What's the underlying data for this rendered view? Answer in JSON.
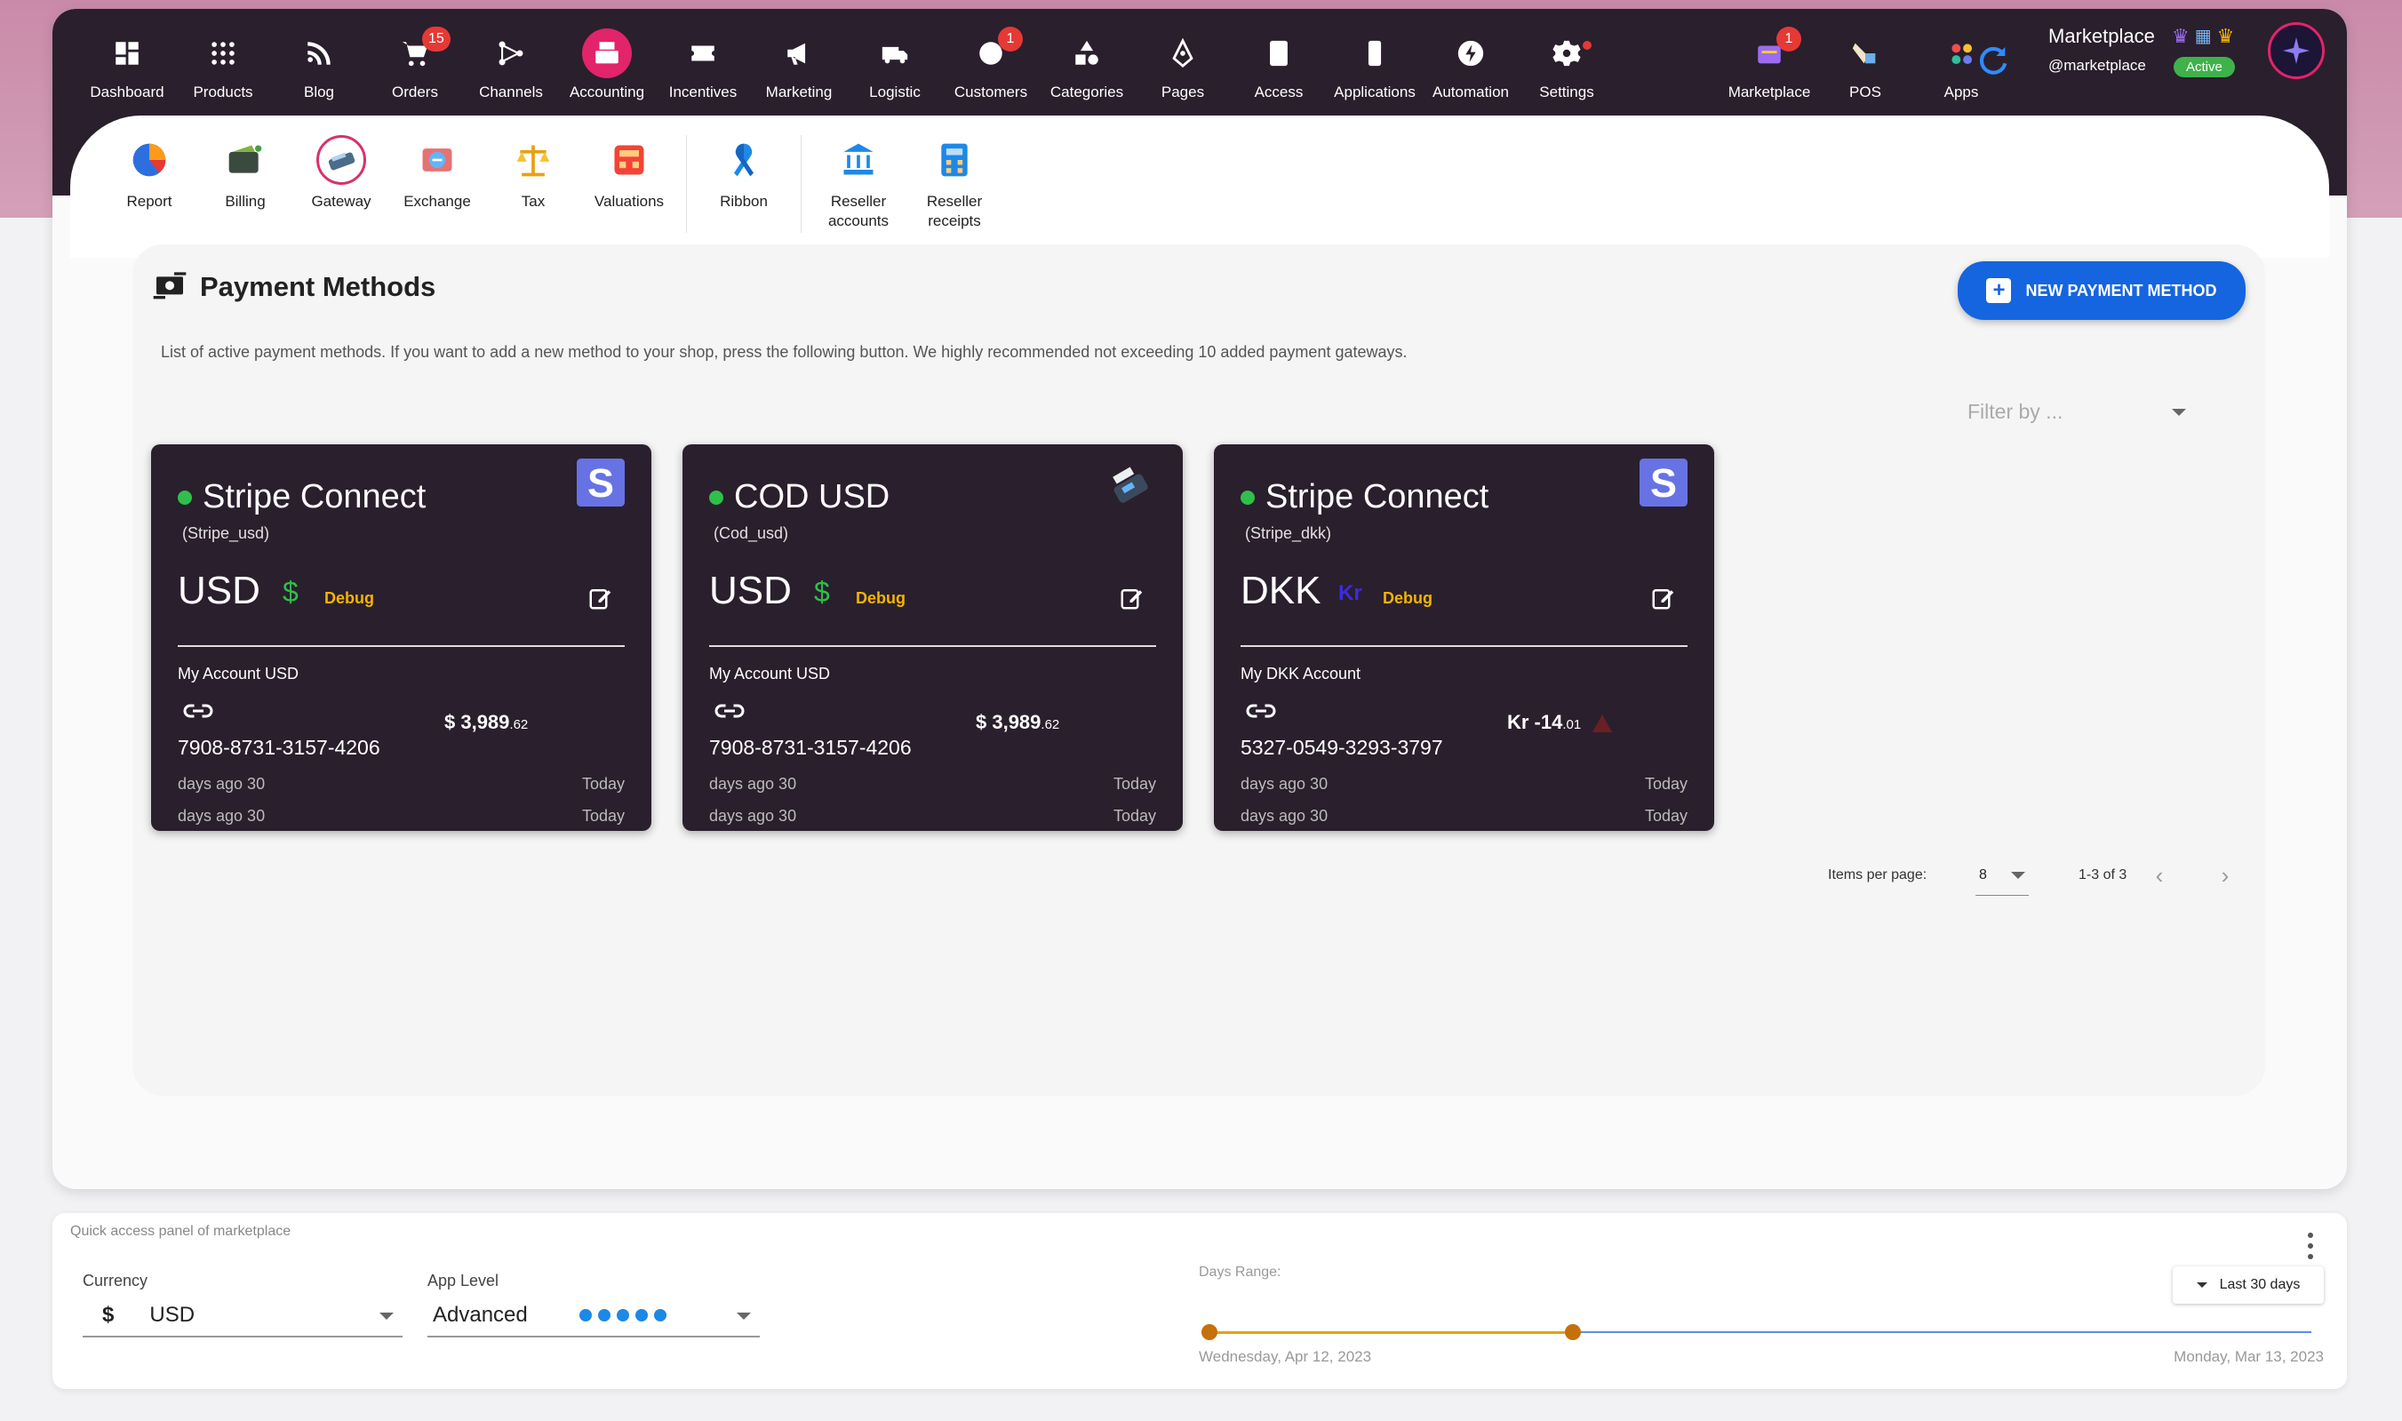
{
  "nav": {
    "items": [
      {
        "label": "Dashboard",
        "icon": "dashboard-icon"
      },
      {
        "label": "Products",
        "icon": "products-icon"
      },
      {
        "label": "Blog",
        "icon": "blog-icon"
      },
      {
        "label": "Orders",
        "icon": "cart-icon",
        "badge": "15"
      },
      {
        "label": "Channels",
        "icon": "channels-icon"
      },
      {
        "label": "Accounting",
        "icon": "cash-register-icon",
        "active": true
      },
      {
        "label": "Incentives",
        "icon": "ticket-icon"
      },
      {
        "label": "Marketing",
        "icon": "megaphone-icon"
      },
      {
        "label": "Logistic",
        "icon": "truck-icon"
      },
      {
        "label": "Customers",
        "icon": "customers-icon",
        "badge": "1"
      },
      {
        "label": "Categories",
        "icon": "shapes-icon"
      },
      {
        "label": "Pages",
        "icon": "pen-tool-icon"
      },
      {
        "label": "Access",
        "icon": "badge-icon"
      },
      {
        "label": "Applications",
        "icon": "phone-icon"
      },
      {
        "label": "Automation",
        "icon": "bolt-icon"
      },
      {
        "label": "Settings",
        "icon": "gear-icon"
      }
    ],
    "right": [
      {
        "label": "Marketplace",
        "icon": "marketplace-icon",
        "badge": "1"
      },
      {
        "label": "POS",
        "icon": "pos-icon"
      },
      {
        "label": "Apps",
        "icon": "apps-icon"
      }
    ]
  },
  "profile": {
    "name": "Marketplace",
    "handle": "@marketplace",
    "status": "Active"
  },
  "subnav": [
    {
      "label": "Report"
    },
    {
      "label": "Billing"
    },
    {
      "label": "Gateway",
      "active": true
    },
    {
      "label": "Exchange"
    },
    {
      "label": "Tax"
    },
    {
      "label": "Valuations"
    },
    {
      "label": "Ribbon"
    },
    {
      "label": "Reseller accounts"
    },
    {
      "label": "Reseller receipts"
    }
  ],
  "page": {
    "title": "Payment Methods",
    "description": "List of active payment methods. If you want to add a new method to your shop, press the following button. We highly recommended not exceeding 10 added payment gateways.",
    "new_button": "NEW PAYMENT METHOD",
    "filter_placeholder": "Filter by ..."
  },
  "cards": [
    {
      "title": "Stripe Connect",
      "code": "(Stripe_usd)",
      "currency": "USD",
      "symbol": "$",
      "debug": "Debug",
      "account": "My Account USD",
      "number": "7908-8731-3157-4206",
      "amount_main": "$ 3,989",
      "amount_dec": ".62",
      "ago1": "days ago 30",
      "ago2": "days ago 30",
      "today1": "Today",
      "today2": "Today",
      "logo": "stripe-logo-icon"
    },
    {
      "title": "COD USD",
      "code": "(Cod_usd)",
      "currency": "USD",
      "symbol": "$",
      "debug": "Debug",
      "account": "My Account USD",
      "number": "7908-8731-3157-4206",
      "amount_main": "$ 3,989",
      "amount_dec": ".62",
      "ago1": "days ago 30",
      "ago2": "days ago 30",
      "today1": "Today",
      "today2": "Today",
      "logo": "pos-terminal-icon"
    },
    {
      "title": "Stripe Connect",
      "code": "(Stripe_dkk)",
      "currency": "DKK",
      "symbol": "Kr",
      "debug": "Debug",
      "account": "My DKK Account",
      "number": "5327-0549-3293-3797",
      "amount_main": "Kr -14",
      "amount_dec": ".01",
      "ago1": "days ago 30",
      "ago2": "days ago 30",
      "today1": "Today",
      "today2": "Today",
      "logo": "stripe-logo-icon"
    }
  ],
  "pagination": {
    "items_per_page_label": "Items per page:",
    "items_per_page": "8",
    "range": "1-3 of 3"
  },
  "quick_panel": {
    "title": "Quick access panel of marketplace",
    "currency_label": "Currency",
    "currency_symbol": "$",
    "currency_value": "USD",
    "app_level_label": "App Level",
    "app_level_value": "Advanced",
    "app_level_dots": 5,
    "days_range_label": "Days Range:",
    "days_range_button": "Last 30 days",
    "date_start": "Wednesday, Apr 12, 2023",
    "date_end": "Monday, Mar 13, 2023",
    "slider_fraction": 0.33
  },
  "colors": {
    "dark": "#2a1f2d",
    "accent": "#e2246a",
    "primary": "#1565e0",
    "green": "#2fbf4a",
    "debug": "#f5b400"
  }
}
